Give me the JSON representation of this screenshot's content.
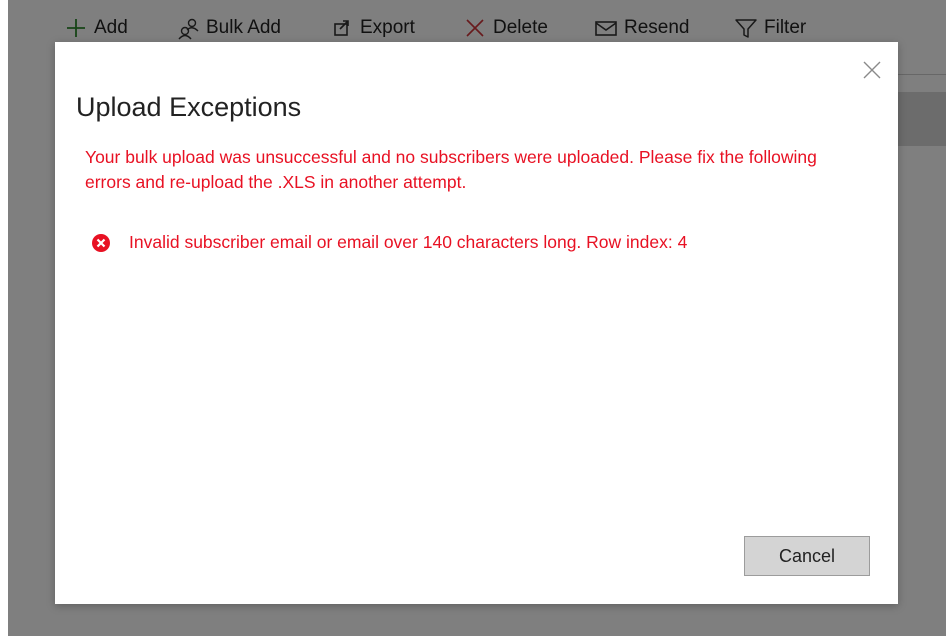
{
  "toolbar": {
    "add_label": "Add",
    "bulk_add_label": "Bulk Add",
    "export_label": "Export",
    "delete_label": "Delete",
    "resend_label": "Resend",
    "filter_label": "Filter"
  },
  "dialog": {
    "title": "Upload Exceptions",
    "message": "Your bulk upload was unsuccessful and no subscribers were uploaded.  Please fix the following errors and re-upload the .XLS in another attempt.",
    "errors": [
      {
        "text": "Invalid subscriber email or email over 140 characters long. Row index: 4"
      }
    ],
    "cancel_label": "Cancel"
  },
  "colors": {
    "error": "#e81123",
    "add_icon": "#2e8b2e",
    "delete_icon": "#d13438"
  },
  "icons": {
    "add": "plus-icon",
    "bulk_add": "people-icon",
    "export": "export-icon",
    "delete": "x-icon",
    "resend": "envelope-icon",
    "filter": "funnel-icon",
    "close": "close-icon",
    "error": "error-circle-icon"
  }
}
